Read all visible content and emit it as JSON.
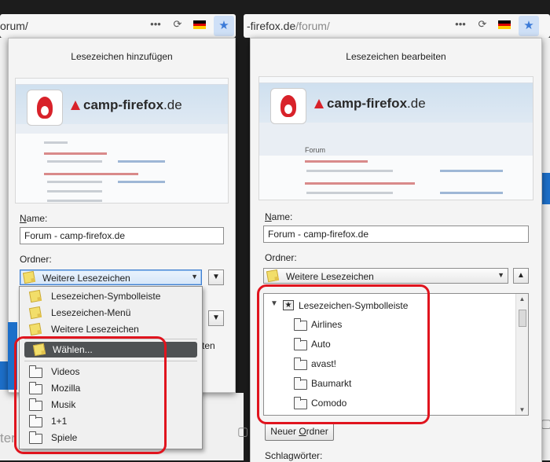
{
  "left": {
    "url_text": "orum/",
    "panel_title": "Lesezeichen hinzufügen",
    "preview_brand": "camp-firefox",
    "preview_brand_tld": ".de",
    "name_label": "Name:",
    "name_value": "Forum - camp-firefox.de",
    "folder_label": "Ordner:",
    "folder_selected": "Weitere Lesezeichen",
    "menu_top": [
      "Lesezeichen-Symbolleiste",
      "Lesezeichen-Menü",
      "Weitere Lesezeichen"
    ],
    "menu_choose": "Wählen...",
    "menu_folders": [
      "Videos",
      "Mozilla",
      "Musik",
      "1+1",
      "Spiele"
    ],
    "partial_text": "ten",
    "bg_text": "ter"
  },
  "right": {
    "url_prefix": "-firefox.de",
    "url_path": "/forum/",
    "panel_title": "Lesezeichen bearbeiten",
    "preview_brand": "camp-firefox",
    "preview_brand_tld": ".de",
    "preview_forum": "Forum",
    "name_label": "Name:",
    "name_value": "Forum - camp-firefox.de",
    "folder_label": "Ordner:",
    "folder_selected": "Weitere Lesezeichen",
    "tree_root": "Lesezeichen-Symbolleiste",
    "tree_items": [
      "Airlines",
      "Auto",
      "avast!",
      "Baumarkt",
      "Comodo"
    ],
    "new_folder_button": "Neuer Ordner",
    "tags_label": "Schlagwörter:"
  },
  "icons": {
    "more": "•••",
    "reload": "⟳",
    "star": "★"
  },
  "colors": {
    "highlight_box": "#e0141e",
    "star_accent": "#3a7ad8",
    "brand_red": "#d8222a"
  }
}
